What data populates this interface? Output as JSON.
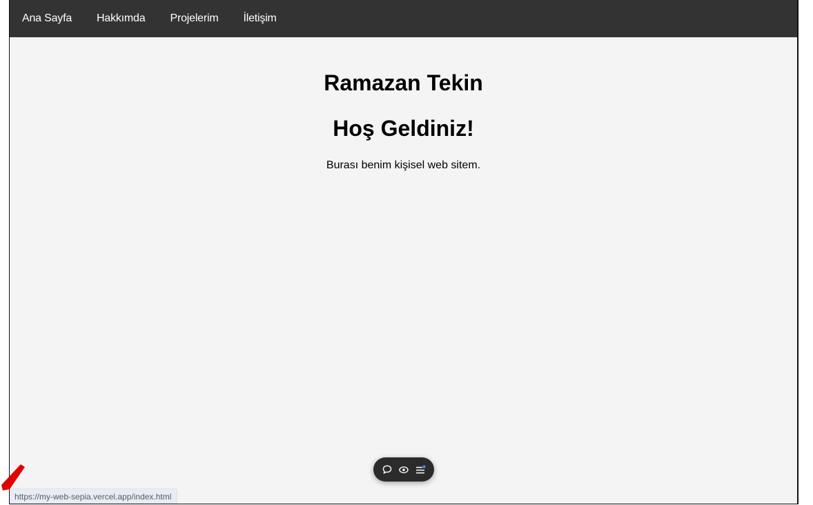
{
  "nav": {
    "items": [
      "Ana Sayfa",
      "Hakkımda",
      "Projelerim",
      "İletişim"
    ]
  },
  "hero": {
    "name": "Ramazan Tekin",
    "welcome": "Hoş Geldiniz!",
    "subtitle": "Burası benim kişisel web sitem."
  },
  "toolbar": {
    "icons": [
      "comment-icon",
      "eye-icon",
      "menu-icon"
    ]
  },
  "status_bar": {
    "url": "https://my-web-sepia.vercel.app/index.html"
  },
  "colors": {
    "nav_background": "#333333",
    "page_background": "#f4f4f4",
    "nav_text": "#ffffff",
    "cursor": "#e00000"
  }
}
